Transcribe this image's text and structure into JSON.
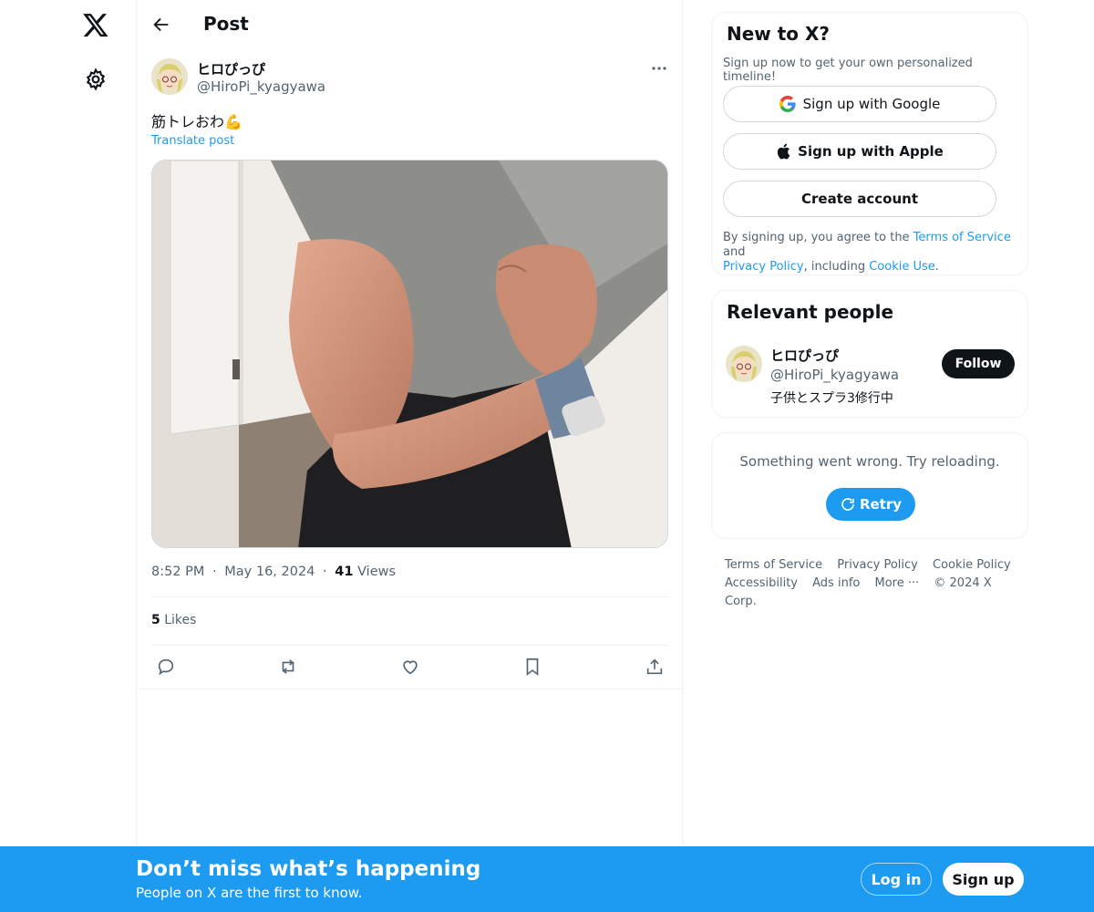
{
  "header": {
    "title": "Post"
  },
  "post": {
    "author_name": "ヒロぴっぴ",
    "author_handle": "@HiroPi_kyagyawa",
    "text": "筋トレおわ💪",
    "translate_label": "Translate post",
    "time": "8:52 PM",
    "date": "May 16, 2024",
    "views_count": "41",
    "views_label": "Views",
    "likes_count": "5",
    "likes_label": "Likes",
    "separator": "·"
  },
  "signup_card": {
    "title": "New to X?",
    "subtitle": "Sign up now to get your own personalized timeline!",
    "google_label": "Sign up with Google",
    "apple_label": "Sign up with Apple",
    "create_label": "Create account",
    "legal_prefix": "By signing up, you agree to the ",
    "terms": "Terms of Service",
    "and": " and",
    "privacy": "Privacy Policy",
    "including": ", including ",
    "cookie": "Cookie Use",
    "period": "."
  },
  "relevant": {
    "title": "Relevant people",
    "name": "ヒロぴっぴ",
    "handle": "@HiroPi_kyagyawa",
    "bio": "子供とスプラ3修行中",
    "follow_label": "Follow"
  },
  "error_card": {
    "message": "Something went wrong. Try reloading.",
    "retry_label": "Retry"
  },
  "footer": {
    "links": [
      "Terms of Service",
      "Privacy Policy",
      "Cookie Policy",
      "Accessibility",
      "Ads info",
      "More ···",
      "© 2024 X Corp."
    ]
  },
  "bottom_bar": {
    "title": "Don’t miss what’s happening",
    "subtitle": "People on X are the first to know.",
    "login_label": "Log in",
    "signup_label": "Sign up"
  },
  "colors": {
    "accent": "#1d9bf0",
    "text": "#0f1419",
    "muted": "#536471"
  }
}
